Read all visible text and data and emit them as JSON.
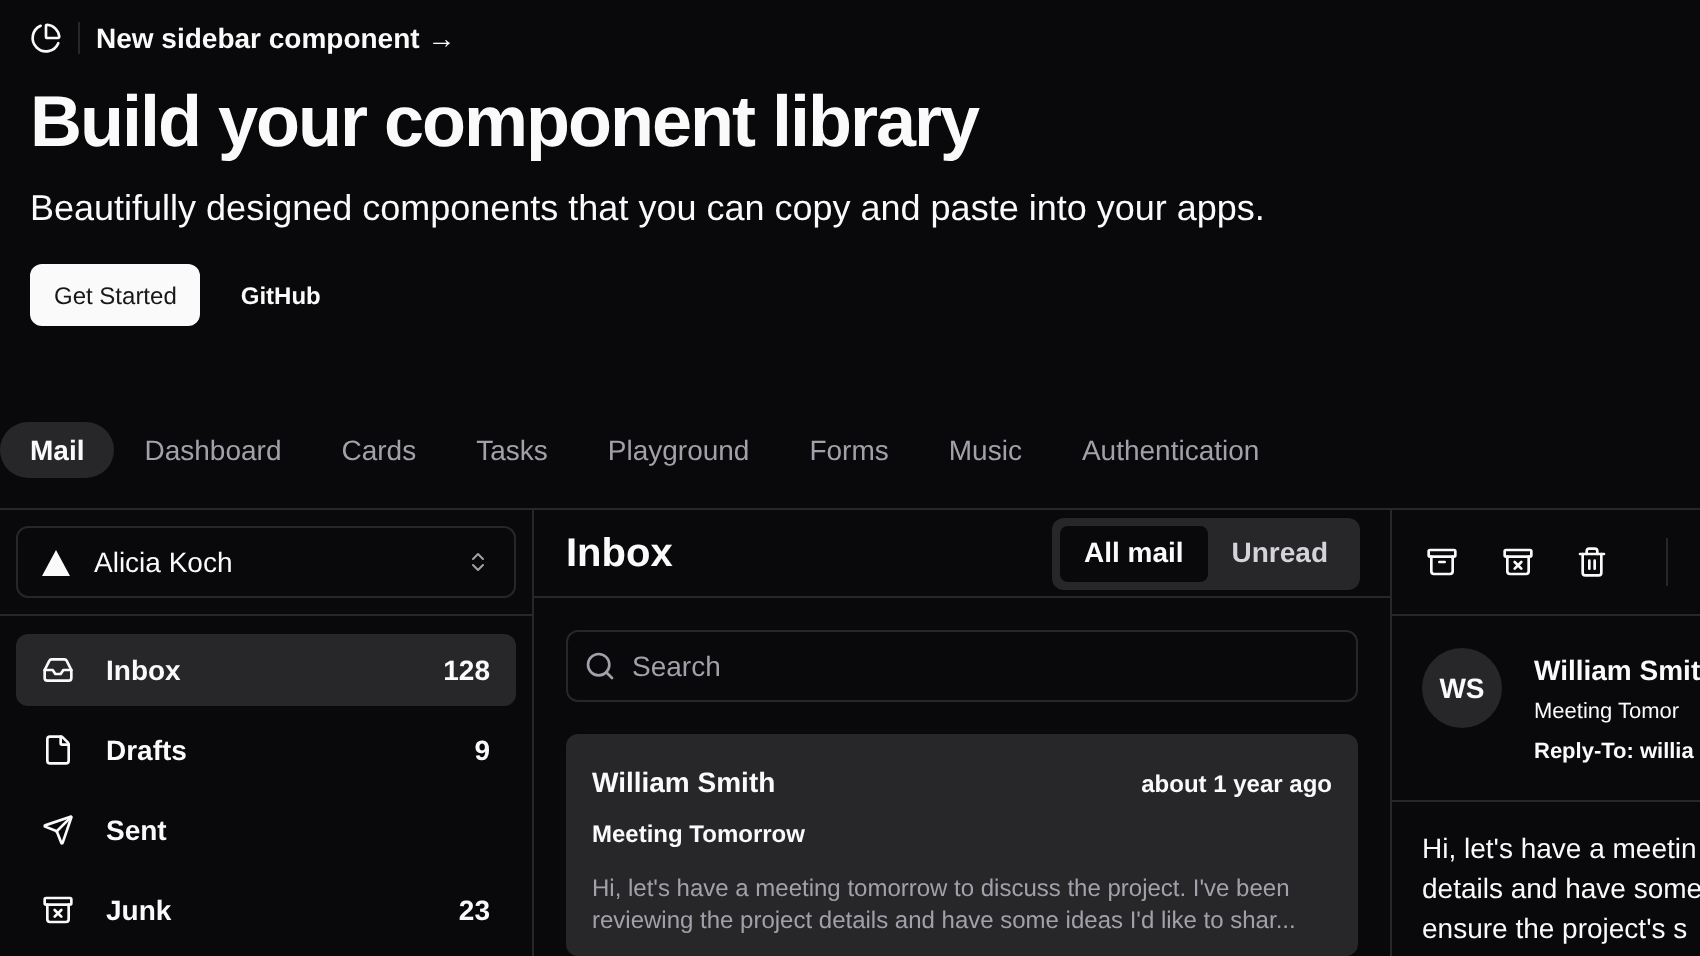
{
  "announcement": {
    "label": "New sidebar component",
    "arrow": "→"
  },
  "hero": {
    "title": "Build your component library",
    "subtitle": "Beautifully designed components that you can copy and paste into your apps.",
    "buttons": [
      {
        "label": "Get Started",
        "kind": "primary"
      },
      {
        "label": "GitHub",
        "kind": "ghost"
      }
    ]
  },
  "tabs": [
    {
      "label": "Mail",
      "selected": true
    },
    {
      "label": "Dashboard",
      "selected": false
    },
    {
      "label": "Cards",
      "selected": false
    },
    {
      "label": "Tasks",
      "selected": false
    },
    {
      "label": "Playground",
      "selected": false
    },
    {
      "label": "Forms",
      "selected": false
    },
    {
      "label": "Music",
      "selected": false
    },
    {
      "label": "Authentication",
      "selected": false
    }
  ],
  "sidebar": {
    "account": "Alicia Koch",
    "items": [
      {
        "label": "Inbox",
        "count": "128",
        "selected": true
      },
      {
        "label": "Drafts",
        "count": "9",
        "selected": false
      },
      {
        "label": "Sent",
        "selected": false
      },
      {
        "label": "Junk",
        "count": "23",
        "selected": false
      }
    ]
  },
  "inbox": {
    "title": "Inbox",
    "filters": [
      {
        "label": "All mail",
        "selected": true
      },
      {
        "label": "Unread",
        "selected": false
      }
    ],
    "search": {
      "placeholder": "Search"
    },
    "messages": [
      {
        "sender": "William Smith",
        "time": "about 1 year ago",
        "subject": "Meeting Tomorrow",
        "preview": "Hi, let's have a meeting tomorrow to discuss the project. I've been reviewing the project details and have some ideas I'd like to shar...",
        "selected": true
      }
    ]
  },
  "detail": {
    "initials": "WS",
    "sender": "William Smit",
    "subject": "Meeting Tomor",
    "reply_to": "Reply-To: willia",
    "body_lines": [
      "Hi, let's have a meetin",
      "details and have some",
      "ensure the project's s"
    ]
  }
}
